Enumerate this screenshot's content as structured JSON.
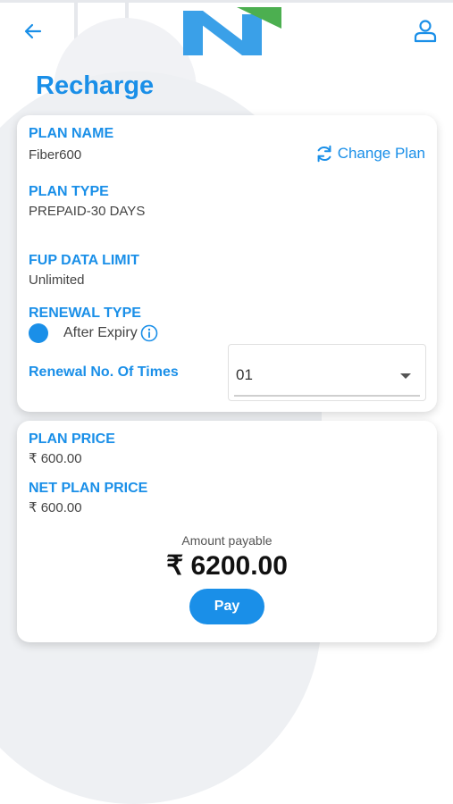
{
  "header": {
    "back_icon": "back-arrow-icon",
    "logo_icon": "brand-logo",
    "user_icon": "user-profile-icon"
  },
  "page": {
    "title": "Recharge"
  },
  "plan_card": {
    "plan_name_label": "PLAN NAME",
    "plan_name_value": "Fiber600",
    "change_plan_label": "Change Plan",
    "plan_type_label": "PLAN TYPE",
    "plan_type_value": "PREPAID-30 DAYS",
    "fup_label": "FUP DATA LIMIT",
    "fup_value": "Unlimited",
    "renewal_type_label": "RENEWAL TYPE",
    "renewal_option": "After Expiry",
    "renewal_times_label": "Renewal No. Of Times",
    "renewal_times_value": "01"
  },
  "price_card": {
    "plan_price_label": "PLAN PRICE",
    "plan_price_value": "₹ 600.00",
    "net_price_label": "NET PLAN PRICE",
    "net_price_value": "₹ 600.00",
    "amount_label": "Amount payable",
    "amount_value": "₹ 6200.00",
    "pay_label": "Pay"
  },
  "colors": {
    "accent": "#1a8fe8",
    "logo_green": "#4caf50"
  }
}
